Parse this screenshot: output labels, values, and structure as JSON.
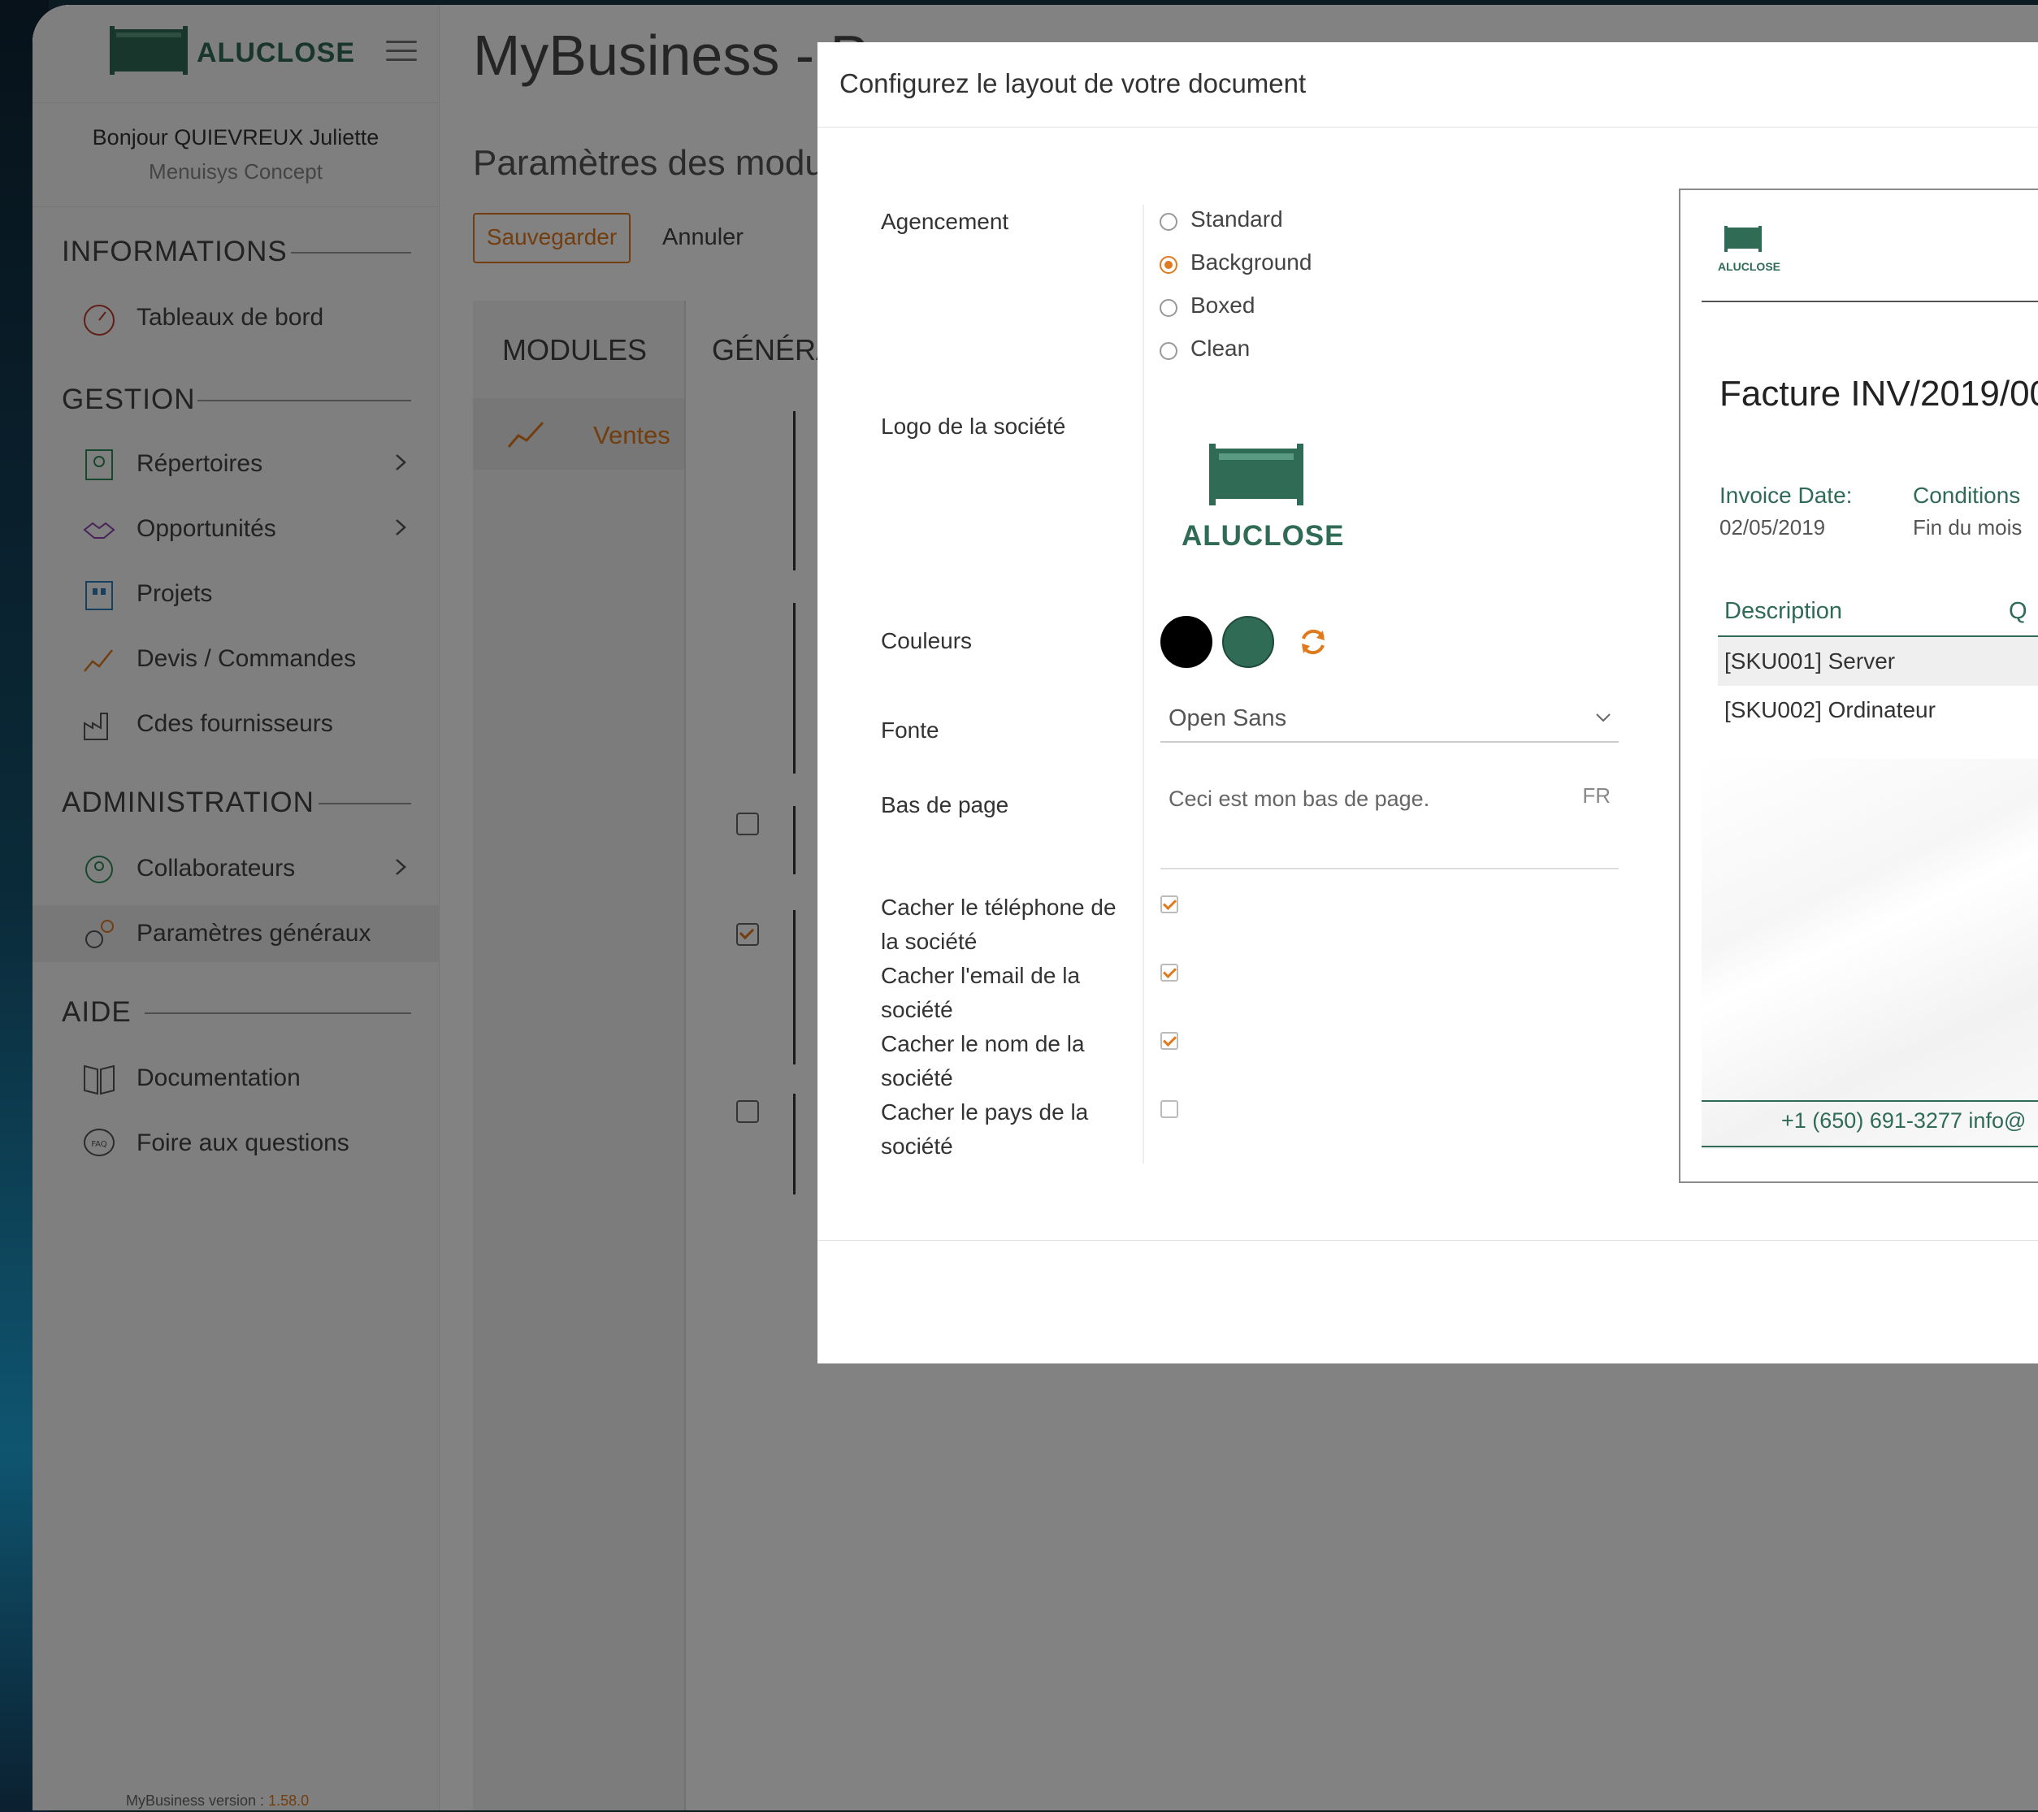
{
  "brand": {
    "name": "ALUCLOSE",
    "logo_icon": "aluclose-logo",
    "accent": "#2f6b55",
    "orange": "#e07a1f"
  },
  "user": {
    "greeting": "Bonjour QUIEVREUX Juliette",
    "company": "Menuisys Concept"
  },
  "sidebar": {
    "sections": [
      {
        "title": "INFORMATIONS",
        "items": [
          {
            "label": "Tableaux de bord",
            "icon": "dashboard-gauge-icon"
          }
        ]
      },
      {
        "title": "GESTION",
        "items": [
          {
            "label": "Répertoires",
            "icon": "contacts-book-icon",
            "chevron": true
          },
          {
            "label": "Opportunités",
            "icon": "handshake-icon",
            "chevron": true
          },
          {
            "label": "Projets",
            "icon": "building-icon"
          },
          {
            "label": "Devis / Commandes",
            "icon": "trend-chart-icon"
          },
          {
            "label": "Cdes fournisseurs",
            "icon": "factory-icon"
          }
        ]
      },
      {
        "title": "ADMINISTRATION",
        "items": [
          {
            "label": "Collaborateurs",
            "icon": "team-icon",
            "chevron": true
          },
          {
            "label": "Paramètres généraux",
            "icon": "gears-icon",
            "active": true
          }
        ]
      },
      {
        "title": "AIDE",
        "items": [
          {
            "label": "Documentation",
            "icon": "book-icon"
          },
          {
            "label": "Foire aux questions",
            "icon": "faq-bubble-icon"
          }
        ]
      }
    ],
    "version_label": "MyBusiness version : ",
    "version": "1.58.0"
  },
  "main": {
    "title": "MyBusiness - Pa",
    "subtitle": "Paramètres des modul",
    "save_label": "Sauvegarder",
    "cancel_label": "Annuler",
    "tabs": [
      "MODULES",
      "GÉNÉRA"
    ],
    "modules": [
      {
        "label": "Ventes",
        "icon": "sales-trend-icon"
      }
    ]
  },
  "modal": {
    "title": "Configurez le layout de votre document",
    "labels": {
      "layout": "Agencement",
      "logo": "Logo de la société",
      "colors": "Couleurs",
      "font": "Fonte",
      "footer": "Bas de page",
      "hide_phone": "Cacher le téléphone de la société",
      "hide_email": "Cacher l'email de la société",
      "hide_name": "Cacher le nom de la société",
      "hide_country": "Cacher le pays de la société"
    },
    "layout_options": [
      "Standard",
      "Background",
      "Boxed",
      "Clean"
    ],
    "layout_selected": "Background",
    "colors": [
      "#000000",
      "#2f6b55"
    ],
    "font": "Open Sans",
    "footer_text": "Ceci est mon bas de page.",
    "footer_lang": "FR",
    "hide_phone": true,
    "hide_email": true,
    "hide_name": true,
    "hide_country": false
  },
  "preview": {
    "logo_name": "ALUCLOSE",
    "title": "Facture INV/2019/00",
    "invoice_date_label": "Invoice Date:",
    "invoice_date": "02/05/2019",
    "conditions_label": "Conditions",
    "conditions": "Fin du mois",
    "col_description": "Description",
    "col_qty": "Q",
    "lines": [
      "[SKU001] Server",
      "[SKU002] Ordinateur"
    ],
    "footer": "+1 (650) 691-3277   info@"
  }
}
